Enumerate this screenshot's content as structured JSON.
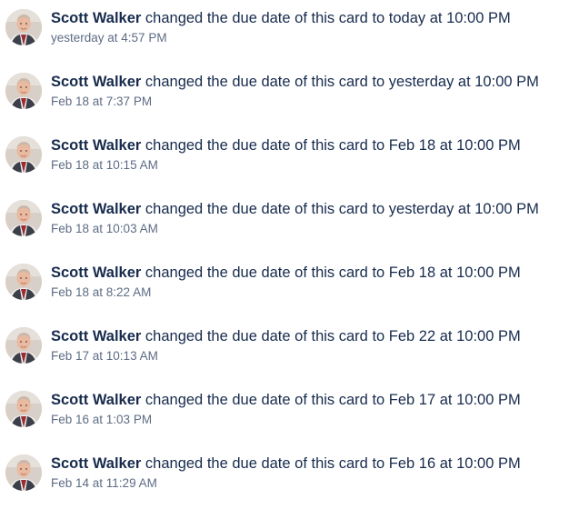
{
  "colors": {
    "text": "#172b4d",
    "meta": "#5e6c84",
    "background": "#ffffff"
  },
  "activities": [
    {
      "member": "Scott Walker",
      "action": " changed the due date of this card to today at 10:00 PM",
      "date": "yesterday at 4:57 PM",
      "avatar_icon": "avatar-photo"
    },
    {
      "member": "Scott Walker",
      "action": " changed the due date of this card to yesterday at 10:00 PM",
      "date": "Feb 18 at 7:37 PM",
      "avatar_icon": "avatar-photo"
    },
    {
      "member": "Scott Walker",
      "action": " changed the due date of this card to Feb 18 at 10:00 PM",
      "date": "Feb 18 at 10:15 AM",
      "avatar_icon": "avatar-photo"
    },
    {
      "member": "Scott Walker",
      "action": " changed the due date of this card to yesterday at 10:00 PM",
      "date": "Feb 18 at 10:03 AM",
      "avatar_icon": "avatar-photo"
    },
    {
      "member": "Scott Walker",
      "action": " changed the due date of this card to Feb 18 at 10:00 PM",
      "date": "Feb 18 at 8:22 AM",
      "avatar_icon": "avatar-photo"
    },
    {
      "member": "Scott Walker",
      "action": " changed the due date of this card to Feb 22 at 10:00 PM",
      "date": "Feb 17 at 10:13 AM",
      "avatar_icon": "avatar-photo"
    },
    {
      "member": "Scott Walker",
      "action": " changed the due date of this card to Feb 17 at 10:00 PM",
      "date": "Feb 16 at 1:03 PM",
      "avatar_icon": "avatar-photo"
    },
    {
      "member": "Scott Walker",
      "action": " changed the due date of this card to Feb 16 at 10:00 PM",
      "date": "Feb 14 at 11:29 AM",
      "avatar_icon": "avatar-photo"
    }
  ]
}
